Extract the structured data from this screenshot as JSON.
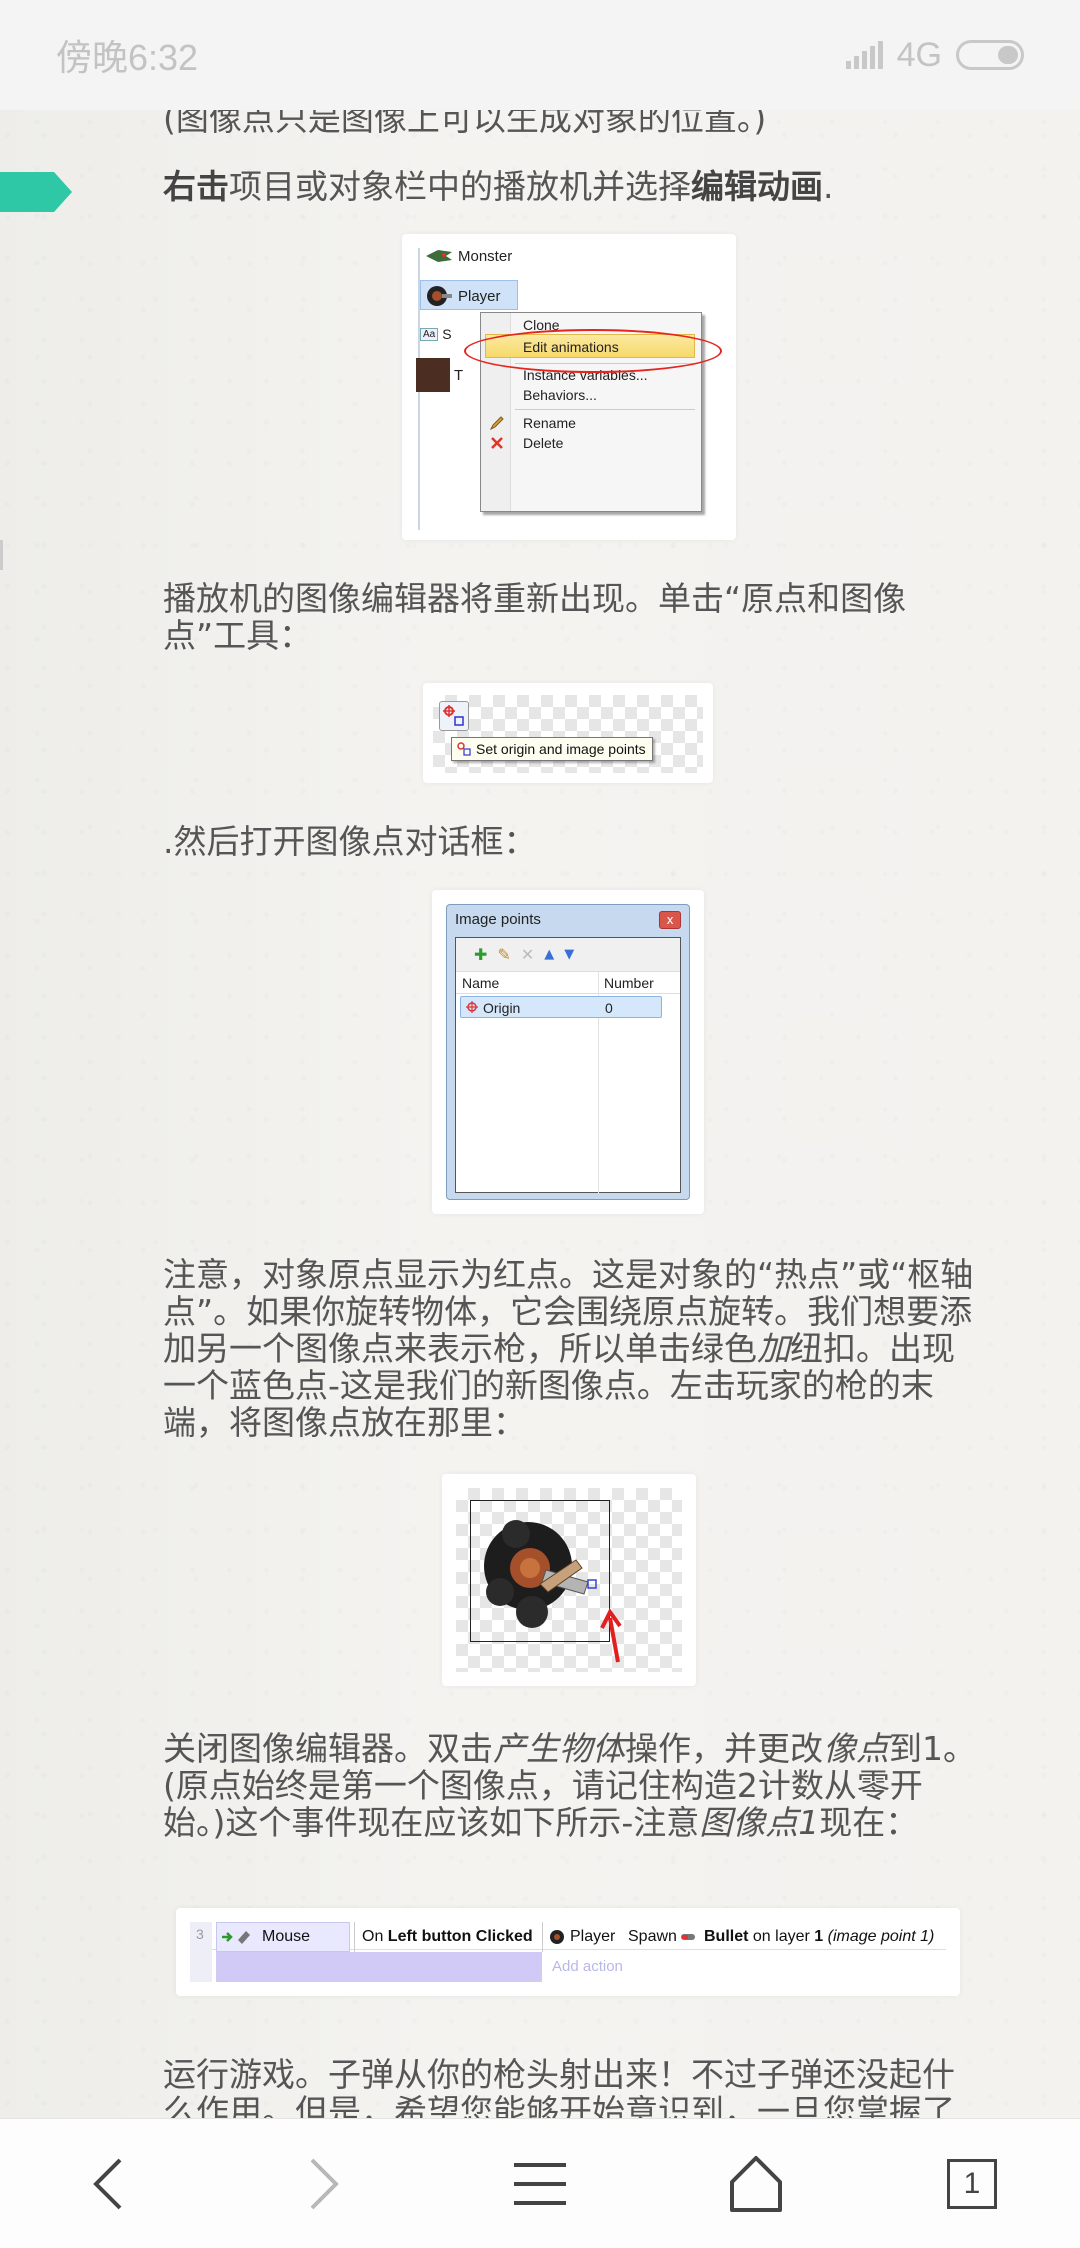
{
  "status_bar": {
    "time": "傍晚6:32",
    "network": "4G"
  },
  "paragraphs": {
    "p0": "(图像点只是图像上可以生成对象的位置。)",
    "p1_a": "右击",
    "p1_b": "项目或对象栏中的播放机并选择",
    "p1_c": "编辑动画",
    "p1_d": ".",
    "p2": "播放机的图像编辑器将重新出现。单击“原点和图像点”工具：",
    "p3": ".然后打开图像点对话框：",
    "p4_a": "注意，对象原点显示为红点。这是对象的“热点”或“枢轴点”。如果你旋转物体，它会围绕原点旋转。我们想要添加另一个图像点来表示枪，所以单击绿色",
    "p4_b": "加",
    "p4_c": "纽扣。出现一个蓝色点-这是我们的新图像点。左击玩家的枪的末端，将图像点放在那里：",
    "p5_a": "关闭图像编辑器。双击",
    "p5_b": "产生物体",
    "p5_c": "操作，并更改",
    "p5_d": "像点",
    "p5_e": "到1。(原点始终是第一个图像点，请记住构造2计数从零开始。)这个事件现在应该如下所示-注意",
    "p5_f": "图像点1",
    "p5_g": "现在：",
    "p6": "运行游戏。子弹从你的枪头射出来！不过子弹还没起什么作用。但是，希望您能够开始意识到，一旦您掌握了事件系统，您就可以非常迅速地构建游戏。"
  },
  "fig1": {
    "objects": [
      "Monster",
      "Player"
    ],
    "menu": [
      "Clone",
      "Edit animations",
      "Instance variables...",
      "Behaviors...",
      "Rename",
      "Delete"
    ],
    "partial_labels": [
      "Aa",
      "S",
      "T"
    ]
  },
  "fig2": {
    "tooltip": "Set origin and image points"
  },
  "fig3": {
    "title": "Image points",
    "close": "x",
    "columns": [
      "Name",
      "Number"
    ],
    "rows": [
      {
        "name": "Origin",
        "number": "0"
      }
    ]
  },
  "fig5": {
    "row_number": "3",
    "object": "Mouse",
    "condition_prefix": "On ",
    "condition_bold": "Left button Clicked",
    "action_object": "Player",
    "action_verb": "Spawn",
    "action_bullet": "Bullet",
    "action_mid": " on layer ",
    "action_layer": "1",
    "action_note": " (image point 1)",
    "add_action": "Add action"
  },
  "bottom_nav": {
    "tab_count": "1"
  },
  "colors": {
    "bookmark": "#2ec8a6",
    "highlight_ring": "#e5261f",
    "text": "#555555"
  }
}
